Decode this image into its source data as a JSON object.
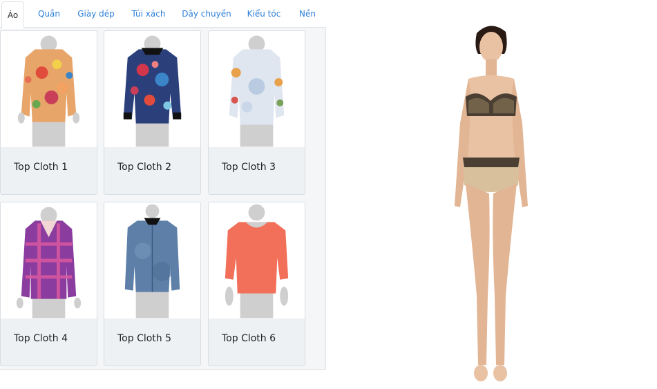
{
  "tabs": [
    {
      "label": "Áo",
      "active": true
    },
    {
      "label": "Quần",
      "active": false
    },
    {
      "label": "Giày dép",
      "active": false
    },
    {
      "label": "Túi xách",
      "active": false
    },
    {
      "label": "Dây chuyền",
      "active": false
    },
    {
      "label": "Kiểu tóc",
      "active": false
    },
    {
      "label": "Nền",
      "active": false
    }
  ],
  "items": [
    {
      "title": "Top Cloth 1",
      "style": "floral-light"
    },
    {
      "title": "Top Cloth 2",
      "style": "floral-dark"
    },
    {
      "title": "Top Cloth 3",
      "style": "floral-white"
    },
    {
      "title": "Top Cloth 4",
      "style": "plaid-purple"
    },
    {
      "title": "Top Cloth 5",
      "style": "denim"
    },
    {
      "title": "Top Cloth 6",
      "style": "coral-blouse"
    }
  ],
  "colors": {
    "accent": "#2d7fd8",
    "item_1": "#e8a56a",
    "item_2": "#2b3f7a",
    "item_3": "#dfe6ef",
    "item_4": "#8a3d9e",
    "item_5": "#5d7fa8",
    "item_6": "#f26f5a"
  }
}
